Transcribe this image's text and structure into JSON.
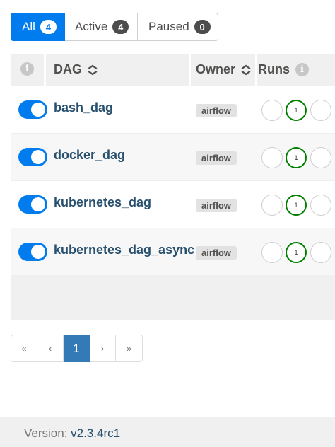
{
  "filters": [
    {
      "label": "All",
      "count": "4",
      "active": true
    },
    {
      "label": "Active",
      "count": "4",
      "active": false
    },
    {
      "label": "Paused",
      "count": "0",
      "active": false
    }
  ],
  "table": {
    "headers": {
      "info_icon": "i",
      "dag": "DAG",
      "owner": "Owner",
      "runs": "Runs",
      "runs_info_icon": "i",
      "sort_icon": "⌃⌄"
    },
    "rows": [
      {
        "dag": "bash_dag",
        "owner": "airflow",
        "enabled": true,
        "runs": [
          "",
          "1",
          ""
        ]
      },
      {
        "dag": "docker_dag",
        "owner": "airflow",
        "enabled": true,
        "runs": [
          "",
          "1",
          ""
        ]
      },
      {
        "dag": "kubernetes_dag",
        "owner": "airflow",
        "enabled": true,
        "runs": [
          "",
          "1",
          ""
        ]
      },
      {
        "dag": "kubernetes_dag_async",
        "owner": "airflow",
        "enabled": true,
        "runs": [
          "",
          "1",
          ""
        ]
      }
    ]
  },
  "pagination": {
    "first": "«",
    "prev": "‹",
    "current": "1",
    "next": "›",
    "last": "»"
  },
  "footer": {
    "version_label": "Version:",
    "version_value": "v2.3.4rc1"
  },
  "colors": {
    "accent": "#017cee",
    "link": "#274f6e",
    "success": "#008000",
    "page_current": "#337ab7"
  }
}
